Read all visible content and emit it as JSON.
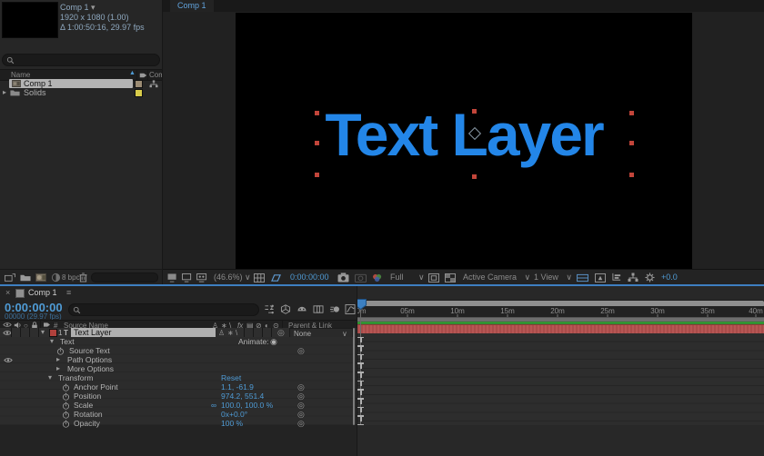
{
  "colors": {
    "accent_blue": "#4f9bd5",
    "canvas_text_blue": "#2386e8",
    "layer_bar_red": "#b5514f",
    "cache_green": "#43b343",
    "selection_gray": "#b4b4b4",
    "handle_red": "#c2453a"
  },
  "glyphs": {
    "caret_down": "▾",
    "caret_right": "▸",
    "select_caret": "∨",
    "sort_asc": "▲",
    "pickwhip": "◎",
    "link": "∞",
    "delta": "Δ",
    "close": "×",
    "panel_menu": "≡",
    "animate_button": "◉",
    "shy": "♙",
    "collapse": "∗",
    "quality": "\\",
    "fx": "fx",
    "frame_blend": "▤",
    "motion_blur": "⊘",
    "adjustment": "◐",
    "three_d": "⊙",
    "solo": "○",
    "hash": "#"
  },
  "project": {
    "comp_name": "Comp 1",
    "comp_size": "1920 x 1080 (1.00)",
    "comp_duration": "1:00:50:16, 29.97 fps",
    "columns": {
      "name": "Name",
      "comment": "Comment"
    },
    "items": [
      {
        "name": "Comp 1"
      },
      {
        "name": "Solids"
      }
    ],
    "bit_depth": "8 bpc"
  },
  "viewer": {
    "tab_label": "Comp 1",
    "canvas_text": "Text Layer",
    "zoom_level": "(46.6%)",
    "preview_time": "0:00:00:00",
    "resolution": "Full",
    "camera": "Active Camera",
    "view_layout": "1 View",
    "exposure": "+0.0"
  },
  "timeline": {
    "tab_label": "Comp 1",
    "timecode": "0:00:00:00",
    "frame_info": "00000 (29.97 fps)",
    "header": {
      "source_name": "Source Name",
      "parent_link": "Parent & Link"
    },
    "layer": {
      "index": "1",
      "type_badge": "T",
      "name": "Text Layer",
      "parent_value": "None"
    },
    "animate_label": "Animate:",
    "rows": [
      {
        "label": "Text"
      },
      {
        "label": "Source Text"
      },
      {
        "label": "Path Options"
      },
      {
        "label": "More Options"
      },
      {
        "label": "Transform",
        "value": "Reset"
      },
      {
        "label": "Anchor Point",
        "value": "1.1, -61.9"
      },
      {
        "label": "Position",
        "value": "974.2, 551.4"
      },
      {
        "label": "Scale",
        "value": "100.0, 100.0 %"
      },
      {
        "label": "Rotation",
        "value": "0x+0.0°"
      },
      {
        "label": "Opacity",
        "value": "100 %"
      }
    ],
    "ruler": [
      "0m",
      "05m",
      "10m",
      "15m",
      "20m",
      "25m",
      "30m",
      "35m",
      "40m"
    ]
  }
}
